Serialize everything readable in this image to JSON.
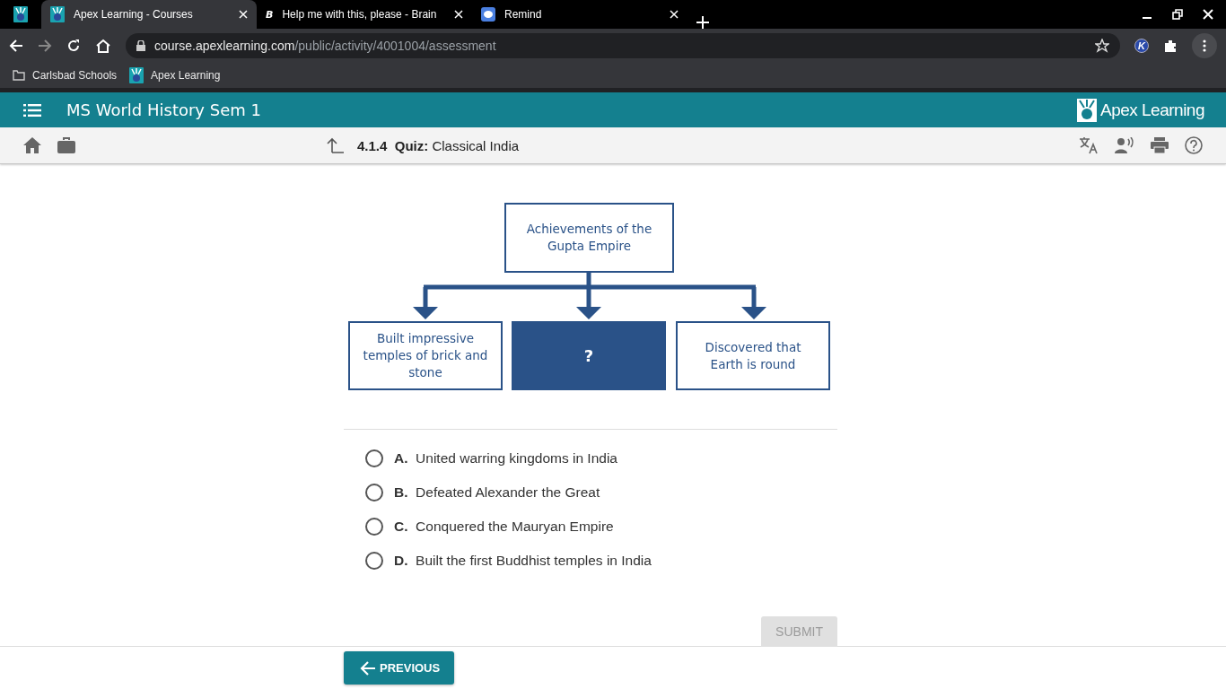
{
  "browser": {
    "tabs": [
      {
        "title": "Apex Learning - Courses",
        "selected": true,
        "kind": "apex"
      },
      {
        "title": "Help me with this, please - Brain",
        "selected": false,
        "kind": "brainly",
        "icon_letter": "B"
      },
      {
        "title": "Remind",
        "selected": false,
        "kind": "remind"
      }
    ],
    "address": {
      "domain": "course.apexlearning.com",
      "path": "/public/activity/4001004/assessment"
    },
    "bookmarks": [
      {
        "label": "Carlsbad Schools",
        "kind": "folder"
      },
      {
        "label": "Apex Learning",
        "kind": "apex"
      }
    ],
    "extension_letter": "K"
  },
  "header": {
    "course_title": "MS World History Sem 1",
    "logo_text": "Apex Learning"
  },
  "toolbar": {
    "number": "4.1.4",
    "type": "Quiz:",
    "title": "Classical India"
  },
  "diagram": {
    "top": "Achievements of the Gupta Empire",
    "boxes": [
      {
        "text": "Built impressive temples of brick and stone",
        "kind": "text"
      },
      {
        "text": "?",
        "kind": "unknown"
      },
      {
        "text": "Discovered that Earth is round",
        "kind": "text"
      }
    ]
  },
  "options": [
    {
      "letter": "A.",
      "text": "United warring kingdoms in India",
      "selected": false
    },
    {
      "letter": "B.",
      "text": "Defeated Alexander the Great",
      "selected": false
    },
    {
      "letter": "C.",
      "text": "Conquered the Mauryan Empire",
      "selected": false
    },
    {
      "letter": "D.",
      "text": "Built the first Buddhist temples in India",
      "selected": false
    }
  ],
  "submit": {
    "label": "SUBMIT",
    "disabled": true
  },
  "previous": {
    "label": "PREVIOUS"
  }
}
